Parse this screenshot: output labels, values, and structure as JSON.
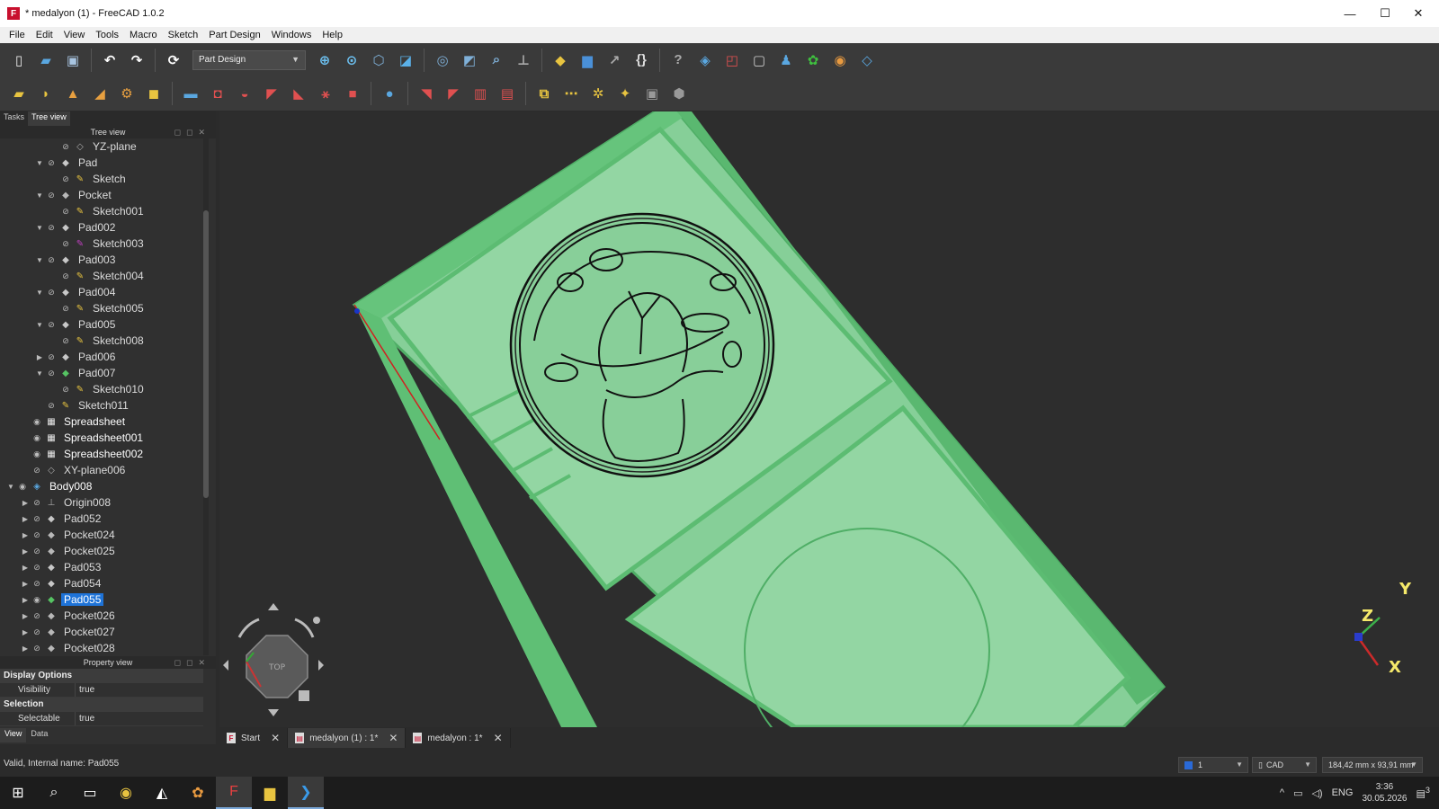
{
  "window": {
    "title": "* medalyon (1) - FreeCAD 1.0.2",
    "minimize_label": "—",
    "maximize_label": "☐",
    "close_label": "✕"
  },
  "menu": [
    "File",
    "Edit",
    "View",
    "Tools",
    "Macro",
    "Sketch",
    "Part Design",
    "Windows",
    "Help"
  ],
  "toolbar": {
    "workbench": "Part Design"
  },
  "left_panel": {
    "tabs": [
      "Tasks",
      "Tree view"
    ],
    "active_tab": "Tree view",
    "tree_header": "Tree view"
  },
  "tree": [
    {
      "label": "YZ-plane",
      "indent": 3,
      "expander": "",
      "icon": "plane-icon",
      "bold": false,
      "selected": false,
      "visible": false
    },
    {
      "label": "Pad",
      "indent": 2,
      "expander": "▼",
      "icon": "pad-icon",
      "bold": false,
      "selected": false,
      "visible": false
    },
    {
      "label": "Sketch",
      "indent": 3,
      "expander": "",
      "icon": "sketch-icon",
      "bold": false,
      "selected": false,
      "visible": false
    },
    {
      "label": "Pocket",
      "indent": 2,
      "expander": "▼",
      "icon": "pocket-icon",
      "bold": false,
      "selected": false,
      "visible": false
    },
    {
      "label": "Sketch001",
      "indent": 3,
      "expander": "",
      "icon": "sketch-icon",
      "bold": false,
      "selected": false,
      "visible": false
    },
    {
      "label": "Pad002",
      "indent": 2,
      "expander": "▼",
      "icon": "pad-icon",
      "bold": false,
      "selected": false,
      "visible": false
    },
    {
      "label": "Sketch003",
      "indent": 3,
      "expander": "",
      "icon": "sketch-error-icon",
      "bold": false,
      "selected": false,
      "visible": false
    },
    {
      "label": "Pad003",
      "indent": 2,
      "expander": "▼",
      "icon": "pad-icon",
      "bold": false,
      "selected": false,
      "visible": false
    },
    {
      "label": "Sketch004",
      "indent": 3,
      "expander": "",
      "icon": "sketch-icon",
      "bold": false,
      "selected": false,
      "visible": false
    },
    {
      "label": "Pad004",
      "indent": 2,
      "expander": "▼",
      "icon": "pad-icon",
      "bold": false,
      "selected": false,
      "visible": false
    },
    {
      "label": "Sketch005",
      "indent": 3,
      "expander": "",
      "icon": "sketch-icon",
      "bold": false,
      "selected": false,
      "visible": false
    },
    {
      "label": "Pad005",
      "indent": 2,
      "expander": "▼",
      "icon": "pad-icon",
      "bold": false,
      "selected": false,
      "visible": false
    },
    {
      "label": "Sketch008",
      "indent": 3,
      "expander": "",
      "icon": "sketch-icon",
      "bold": false,
      "selected": false,
      "visible": false
    },
    {
      "label": "Pad006",
      "indent": 2,
      "expander": "▶",
      "icon": "pad-icon",
      "bold": false,
      "selected": false,
      "visible": false
    },
    {
      "label": "Pad007",
      "indent": 2,
      "expander": "▼",
      "icon": "pad-tip-icon",
      "bold": false,
      "selected": false,
      "visible": false
    },
    {
      "label": "Sketch010",
      "indent": 3,
      "expander": "",
      "icon": "sketch-icon",
      "bold": false,
      "selected": false,
      "visible": false
    },
    {
      "label": "Sketch011",
      "indent": 2,
      "expander": "",
      "icon": "sketch-icon",
      "bold": false,
      "selected": false,
      "visible": false
    },
    {
      "label": "Spreadsheet",
      "indent": 1,
      "expander": "",
      "icon": "spreadsheet-icon",
      "bold": true,
      "selected": false,
      "visible": true
    },
    {
      "label": "Spreadsheet001",
      "indent": 1,
      "expander": "",
      "icon": "spreadsheet-icon",
      "bold": true,
      "selected": false,
      "visible": true
    },
    {
      "label": "Spreadsheet002",
      "indent": 1,
      "expander": "",
      "icon": "spreadsheet-icon",
      "bold": true,
      "selected": false,
      "visible": true
    },
    {
      "label": "XY-plane006",
      "indent": 1,
      "expander": "",
      "icon": "plane-icon",
      "bold": false,
      "selected": false,
      "visible": false
    },
    {
      "label": "Body008",
      "indent": 0,
      "expander": "▼",
      "icon": "body-icon",
      "bold": true,
      "selected": false,
      "visible": true
    },
    {
      "label": "Origin008",
      "indent": 1,
      "expander": "▶",
      "icon": "origin-icon",
      "bold": false,
      "selected": false,
      "visible": false
    },
    {
      "label": "Pad052",
      "indent": 1,
      "expander": "▶",
      "icon": "pad-icon",
      "bold": false,
      "selected": false,
      "visible": false
    },
    {
      "label": "Pocket024",
      "indent": 1,
      "expander": "▶",
      "icon": "pocket-icon",
      "bold": false,
      "selected": false,
      "visible": false
    },
    {
      "label": "Pocket025",
      "indent": 1,
      "expander": "▶",
      "icon": "pocket-icon",
      "bold": false,
      "selected": false,
      "visible": false
    },
    {
      "label": "Pad053",
      "indent": 1,
      "expander": "▶",
      "icon": "pad-icon",
      "bold": false,
      "selected": false,
      "visible": false
    },
    {
      "label": "Pad054",
      "indent": 1,
      "expander": "▶",
      "icon": "pad-icon",
      "bold": false,
      "selected": false,
      "visible": false
    },
    {
      "label": "Pad055",
      "indent": 1,
      "expander": "▶",
      "icon": "pad-tip-icon",
      "bold": false,
      "selected": true,
      "visible": true
    },
    {
      "label": "Pocket026",
      "indent": 1,
      "expander": "▶",
      "icon": "pocket-icon",
      "bold": false,
      "selected": false,
      "visible": false
    },
    {
      "label": "Pocket027",
      "indent": 1,
      "expander": "▶",
      "icon": "pocket-icon",
      "bold": false,
      "selected": false,
      "visible": false
    },
    {
      "label": "Pocket028",
      "indent": 1,
      "expander": "▶",
      "icon": "pocket-icon",
      "bold": false,
      "selected": false,
      "visible": false
    }
  ],
  "property_view": {
    "header": "Property view",
    "groups": [
      {
        "name": "Display Options",
        "rows": [
          {
            "key": "Visibility",
            "value": "true"
          }
        ]
      },
      {
        "name": "Selection",
        "rows": [
          {
            "key": "Selectable",
            "value": "true"
          }
        ]
      }
    ],
    "tabs": [
      "View",
      "Data"
    ]
  },
  "viewport": {
    "axis_labels": {
      "x": "X",
      "y": "Y",
      "z": "Z"
    },
    "navcube_face": "TOP"
  },
  "doc_tabs": [
    {
      "label": "Start",
      "active": false
    },
    {
      "label": "medalyon (1) : 1*",
      "active": true
    },
    {
      "label": "medalyon : 1*",
      "active": false
    }
  ],
  "status": {
    "message": "Valid, Internal name: Pad055",
    "layer": "1",
    "nav_style": "CAD",
    "dimensions": "184,42 mm x 93,91 mm"
  },
  "taskbar": {
    "time": "3:36",
    "date": "30.05.2026",
    "lang": "ENG",
    "notifications": "3"
  },
  "colors": {
    "model_green": "#7fd18f",
    "selection_blue": "#1e73d8",
    "background": "#2d2d2d"
  }
}
